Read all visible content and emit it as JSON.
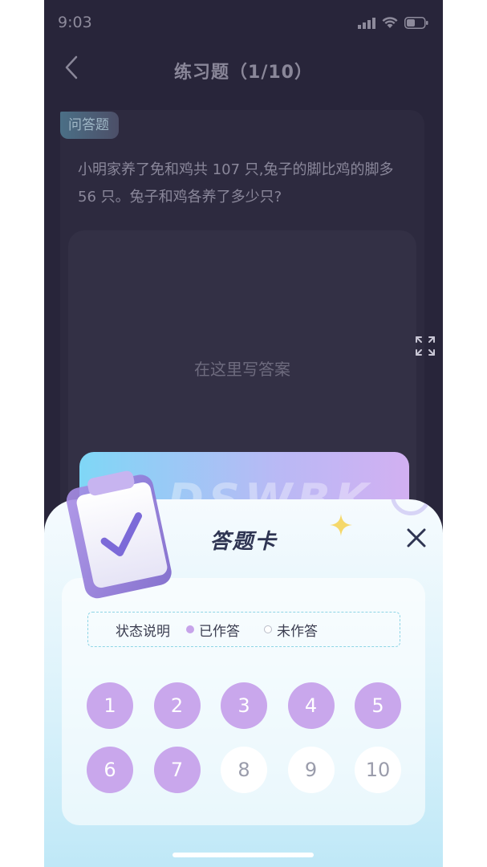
{
  "status_bar": {
    "time": "9:03"
  },
  "nav": {
    "title": "练习题（1/10）"
  },
  "question": {
    "type_badge": "问答题",
    "text": "小明家养了免和鸡共 107 只,兔子的脚比鸡的脚多 56 只。兔子和鸡各养了多少只?",
    "answer_placeholder": "在这里写答案"
  },
  "answer_sheet": {
    "watermark": "DSWBK",
    "title": "答题卡",
    "legend": {
      "label": "状态说明",
      "done_label": "已作答",
      "todo_label": "未作答"
    },
    "questions": [
      {
        "num": "1",
        "answered": true
      },
      {
        "num": "2",
        "answered": true
      },
      {
        "num": "3",
        "answered": true
      },
      {
        "num": "4",
        "answered": true
      },
      {
        "num": "5",
        "answered": true
      },
      {
        "num": "6",
        "answered": true
      },
      {
        "num": "7",
        "answered": true
      },
      {
        "num": "8",
        "answered": false
      },
      {
        "num": "9",
        "answered": false
      },
      {
        "num": "10",
        "answered": false
      }
    ]
  },
  "colors": {
    "answered": "#c9a7ec",
    "unanswered": "#ffffff",
    "page_bg": "#28253a"
  }
}
